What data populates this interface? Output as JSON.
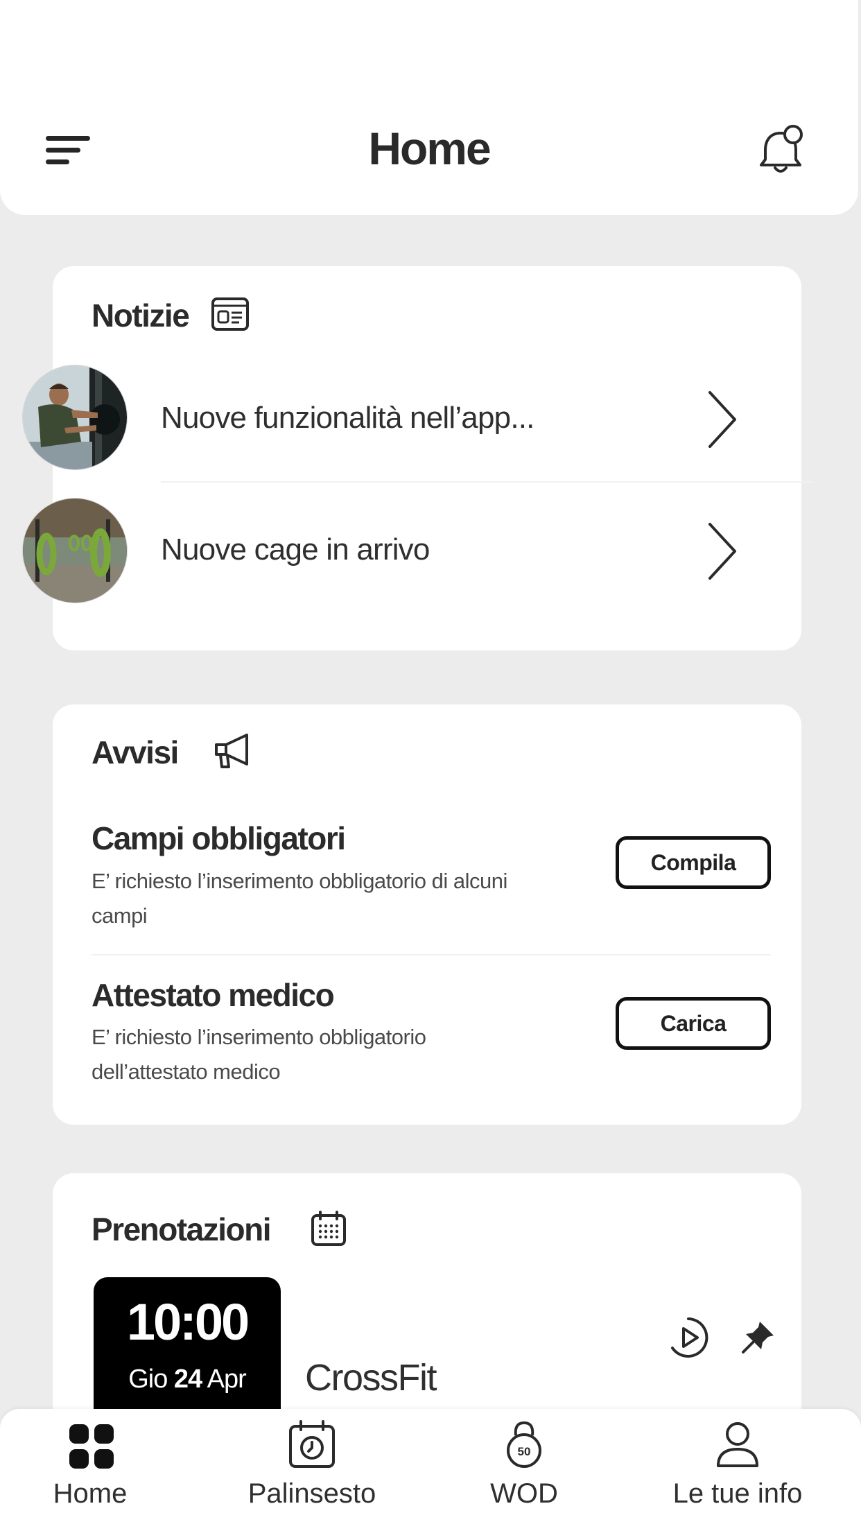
{
  "header": {
    "title": "Home"
  },
  "news": {
    "title": "Notizie",
    "items": [
      {
        "text": "Nuove funzionalità nell’app..."
      },
      {
        "text": "Nuove cage in arrivo"
      }
    ]
  },
  "notices": {
    "title": "Avvisi",
    "items": [
      {
        "title": "Campi obbligatori",
        "desc": "E’ richiesto l’inserimento obbligatorio di alcuni campi",
        "button": "Compila"
      },
      {
        "title": "Attestato medico",
        "desc": "E’ richiesto l’inserimento obbligatorio dell’attestato medico",
        "button": "Carica"
      }
    ]
  },
  "bookings": {
    "title": "Prenotazioni",
    "items": [
      {
        "time": "10:00",
        "day": "Gio",
        "date_num": "24",
        "month": "Apr",
        "course": "CrossFit"
      }
    ]
  },
  "tabbar": {
    "items": [
      {
        "label": "Home",
        "icon": "grid-icon"
      },
      {
        "label": "Palinsesto",
        "icon": "calendar-clock-icon"
      },
      {
        "label": "WOD",
        "icon": "kettlebell-icon",
        "badge": "50"
      },
      {
        "label": "Le tue info",
        "icon": "user-icon"
      }
    ]
  }
}
